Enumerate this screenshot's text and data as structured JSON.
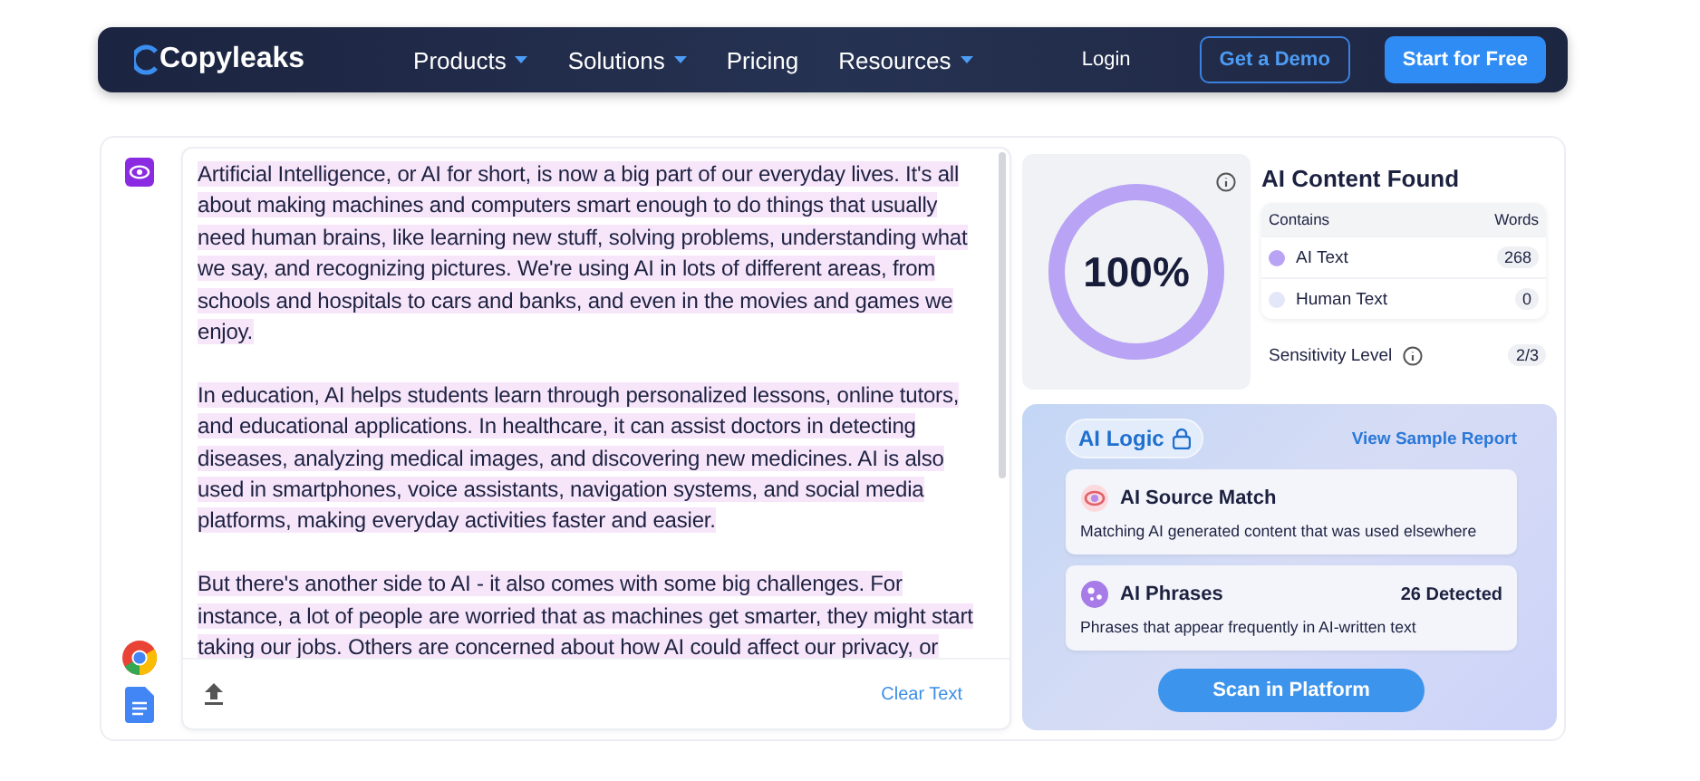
{
  "nav": {
    "logo": "Copyleaks",
    "menu": [
      {
        "label": "Products",
        "dropdown": true
      },
      {
        "label": "Solutions",
        "dropdown": true
      },
      {
        "label": "Pricing",
        "dropdown": false
      },
      {
        "label": "Resources",
        "dropdown": true
      }
    ],
    "login": "Login",
    "demo": "Get a Demo",
    "start": "Start for Free"
  },
  "editor": {
    "paragraphs": [
      "Artificial Intelligence, or AI for short, is now a big part of our everyday lives. It's all about making machines and computers smart enough to do things that usually need human brains, like learning new stuff, solving problems, understanding what we say, and recognizing pictures. We're using AI in lots of different areas, from schools and hospitals to cars and banks, and even in the movies and games we enjoy.",
      "In education, AI helps students learn through personalized lessons, online tutors, and educational applications. In healthcare, it can assist doctors in detecting diseases, analyzing medical images, and discovering new medicines. AI is also used in smartphones, voice assistants, navigation systems, and social media platforms, making everyday activities faster and easier.",
      "But there's another side to AI - it also comes with some big challenges. For instance, a lot of people are worried that as machines get smarter, they might start taking our jobs. Others are concerned about how AI could affect our privacy, or"
    ],
    "clear": "Clear Text"
  },
  "result": {
    "percent": "100%",
    "level": 1,
    "title": "AI Content Found",
    "contains_header": "Contains",
    "words_header": "Words",
    "rows": [
      {
        "label": "AI Text",
        "count": "268",
        "color": "#b9a3f5"
      },
      {
        "label": "Human Text",
        "count": "0",
        "color": "#e3e7f7"
      }
    ],
    "sensitivity_label": "Sensitivity Level",
    "sensitivity": "2/3"
  },
  "logic": {
    "badge": "AI Logic",
    "report_link": "View Sample Report",
    "cards": [
      {
        "kind": "source",
        "title": "AI Source Match",
        "description": "Matching AI generated content that was used elsewhere"
      },
      {
        "kind": "phrases",
        "title": "AI Phrases",
        "count": "26 Detected",
        "description": "Phrases that appear frequently in AI-written text"
      }
    ],
    "scan": "Scan in Platform"
  }
}
